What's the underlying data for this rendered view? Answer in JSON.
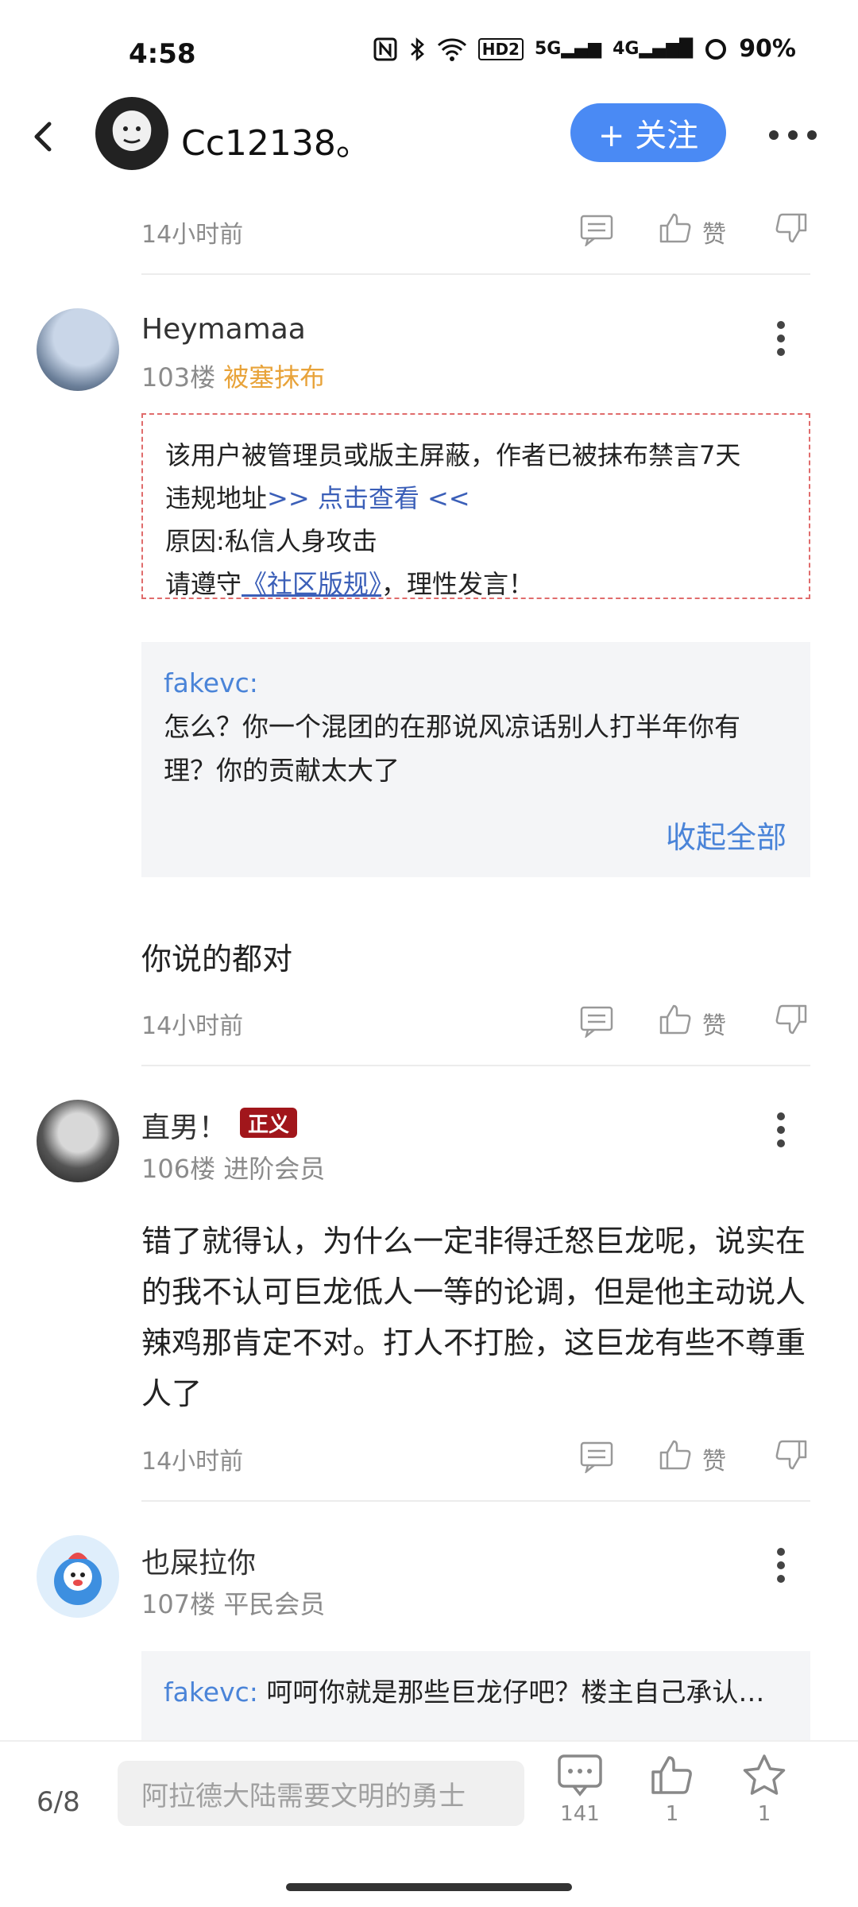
{
  "status": {
    "time": "4:58",
    "battery": "90%",
    "network_5g": "5G",
    "network_4g": "4G",
    "hd": "HD2"
  },
  "header": {
    "username": "Cc12138。",
    "follow_label": "+ 关注"
  },
  "top_post": {
    "time": "14小时前",
    "like_label": "赞"
  },
  "comments": [
    {
      "name": "Heymamaa",
      "floor": "103楼",
      "tag": "被塞抹布",
      "ban_notice": {
        "line1": "该用户被管理员或版主屏蔽，作者已被抹布禁言7天",
        "line2_prefix": "违规地址",
        "line2_link": ">> 点击查看 <<",
        "line3": "原因:私信人身攻击",
        "line4_prefix": "请遵守",
        "line4_link": "《社区版规》",
        "line4_suffix": "，理性发言！"
      },
      "quote_user": "fakevc:",
      "quote_text": "怎么？你一个混团的在那说风凉话别人打半年你有理？你的贡献太大了",
      "collapse_label": "收起全部",
      "body": "你说的都对",
      "time": "14小时前",
      "like_label": "赞"
    },
    {
      "name": "直男！",
      "badge": "正义",
      "floor": "106楼",
      "level": "进阶会员",
      "body": "错了就得认，为什么一定非得迁怒巨龙呢，说实在的我不认可巨龙低人一等的论调，但是他主动说人辣鸡那肯定不对。打人不打脸，这巨龙有些不尊重人了",
      "time": "14小时前",
      "like_label": "赞"
    },
    {
      "name": "也屎拉你",
      "floor": "107楼",
      "level": "平民会员",
      "quote_user": "fakevc:",
      "quote_text": "呵呵你就是那些巨龙仔吧？楼主自己承认…"
    }
  ],
  "bottom_bar": {
    "page_indicator": "6/8",
    "reply_placeholder": "阿拉德大陆需要文明的勇士",
    "comment_count": "141",
    "like_count": "1",
    "star_count": "1"
  },
  "colors": {
    "accent": "#4a8af4",
    "tag_orange": "#e8a33a",
    "quote_blue": "#4a84d8",
    "ban_border": "#e06c6c",
    "badge_red": "#a1161b"
  }
}
